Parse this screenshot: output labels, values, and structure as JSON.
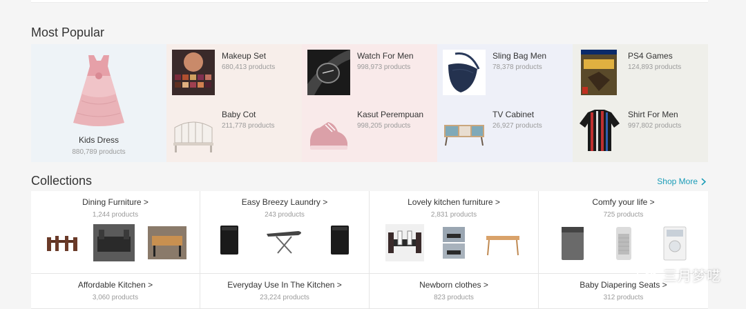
{
  "most_popular": {
    "title": "Most Popular",
    "featured": {
      "name": "Kids Dress",
      "count": "880,789 products",
      "icon": "pink-dress-image",
      "bg": "#eef3f7"
    },
    "items": [
      {
        "name": "Makeup Set",
        "count": "680,413 products",
        "icon": "eyeshadow-palette-image",
        "bg": "#f7eeea"
      },
      {
        "name": "Watch For Men",
        "count": "998,973 products",
        "icon": "watch-image",
        "bg": "#f9eaea"
      },
      {
        "name": "Sling Bag Men",
        "count": "78,378 products",
        "icon": "sling-bag-image",
        "bg": "#eef0f8"
      },
      {
        "name": "PS4 Games",
        "count": "124,893 products",
        "icon": "ps4-game-case-image",
        "bg": "#efefea"
      },
      {
        "name": "Baby Cot",
        "count": "211,778 products",
        "icon": "baby-cot-image",
        "bg": "#f7eeea"
      },
      {
        "name": "Kasut Perempuan",
        "count": "998,205 products",
        "icon": "pink-sneaker-image",
        "bg": "#f9eaea"
      },
      {
        "name": "TV Cabinet",
        "count": "26,927 products",
        "icon": "tv-cabinet-image",
        "bg": "#eef0f8"
      },
      {
        "name": "Shirt For Men",
        "count": "997,802 products",
        "icon": "striped-shirt-image",
        "bg": "#efefea"
      }
    ]
  },
  "collections": {
    "title": "Collections",
    "shop_more": "Shop More",
    "items": [
      {
        "name": "Dining Furniture >",
        "count": "1,244 products"
      },
      {
        "name": "Easy Breezy Laundry >",
        "count": "243 products"
      },
      {
        "name": "Lovely kitchen furniture >",
        "count": "2,831 products"
      },
      {
        "name": "Comfy your life >",
        "count": "725 products"
      },
      {
        "name": "Affordable Kitchen >",
        "count": "3,060 products"
      },
      {
        "name": "Everyday Use In The Kitchen >",
        "count": "23,224 products"
      },
      {
        "name": "Newborn clothes >",
        "count": "823 products"
      },
      {
        "name": "Baby Diapering Seats >",
        "count": "312 products"
      }
    ]
  },
  "watermark": {
    "text": "三月梦呓"
  },
  "colors": {
    "accent": "#1a9cb7",
    "muted_text": "#9a9a9a",
    "page_bg": "#f5f5f5"
  }
}
